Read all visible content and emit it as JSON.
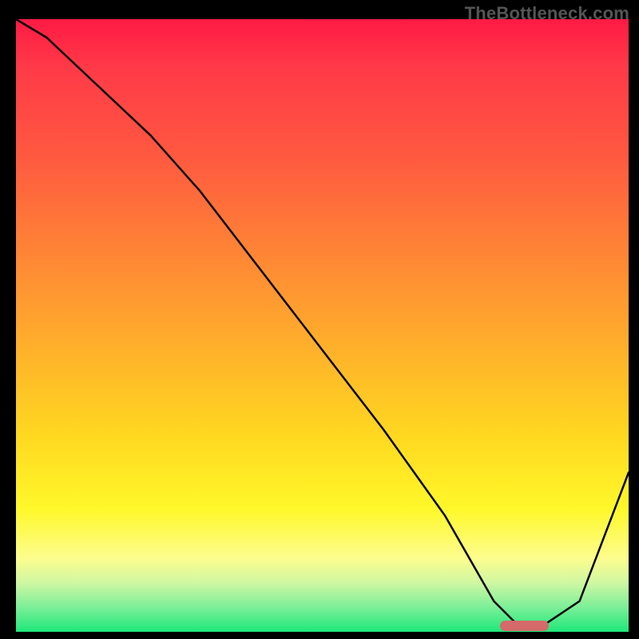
{
  "watermark": "TheBottleneck.com",
  "chart_data": {
    "type": "line",
    "title": "",
    "xlabel": "",
    "ylabel": "",
    "xlim": [
      0,
      100
    ],
    "ylim": [
      0,
      100
    ],
    "grid": false,
    "background": "red-yellow-green vertical gradient (high=red, low=green)",
    "series": [
      {
        "name": "bottleneck-curve",
        "x": [
          0,
          5,
          22,
          30,
          40,
          50,
          60,
          70,
          78,
          82,
          86,
          92,
          100
        ],
        "values": [
          100,
          97,
          81,
          72,
          59,
          46,
          33,
          19,
          5,
          1,
          1,
          5,
          26
        ]
      }
    ],
    "annotations": [
      {
        "name": "optimal-range-marker",
        "type": "bar-segment",
        "x_start": 79,
        "x_end": 87,
        "y": 1,
        "color": "#d46a6a"
      }
    ]
  }
}
